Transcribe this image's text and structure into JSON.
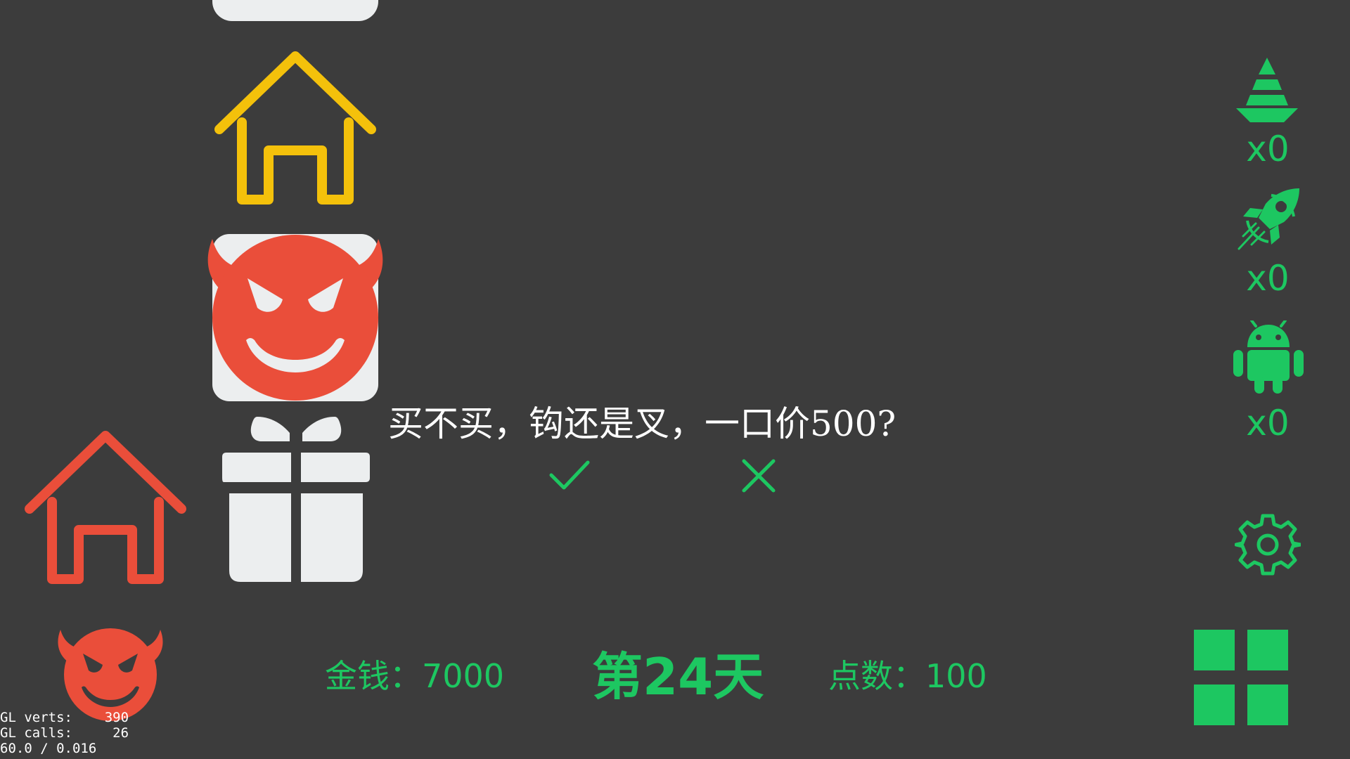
{
  "dialog": {
    "question": "买不买，钩还是叉，一口价500?",
    "confirm_icon": "check-icon",
    "cancel_icon": "cross-icon"
  },
  "status": {
    "money": "金钱：7000",
    "day": "第24天",
    "points": "点数：100"
  },
  "inventory": [
    {
      "icon": "traffic-cone-icon",
      "count": "x0"
    },
    {
      "icon": "rocket-icon",
      "count": "x0"
    },
    {
      "icon": "android-icon",
      "count": "x0"
    }
  ],
  "board": [
    {
      "icon": "card-tile"
    },
    {
      "icon": "house-icon",
      "color": "#f4c10b"
    },
    {
      "icon": "devil-face-icon",
      "color": "#ea4e3a"
    },
    {
      "icon": "gift-icon",
      "color": "#eceeef"
    },
    {
      "icon": "house-icon",
      "color": "#ea4e3a"
    },
    {
      "icon": "devil-face-icon",
      "color": "#ea4e3a"
    }
  ],
  "controls": {
    "settings_icon": "gear-icon",
    "menu_icon": "grid-icon"
  },
  "debug": {
    "lines": "GL verts:    390\nGL calls:     26\n60.0 / 0.016"
  },
  "colors": {
    "background": "#3c3c3c",
    "accent": "#1dc761",
    "danger": "#ea4e3a",
    "warning": "#f4c10b",
    "tile": "#eceeef"
  }
}
